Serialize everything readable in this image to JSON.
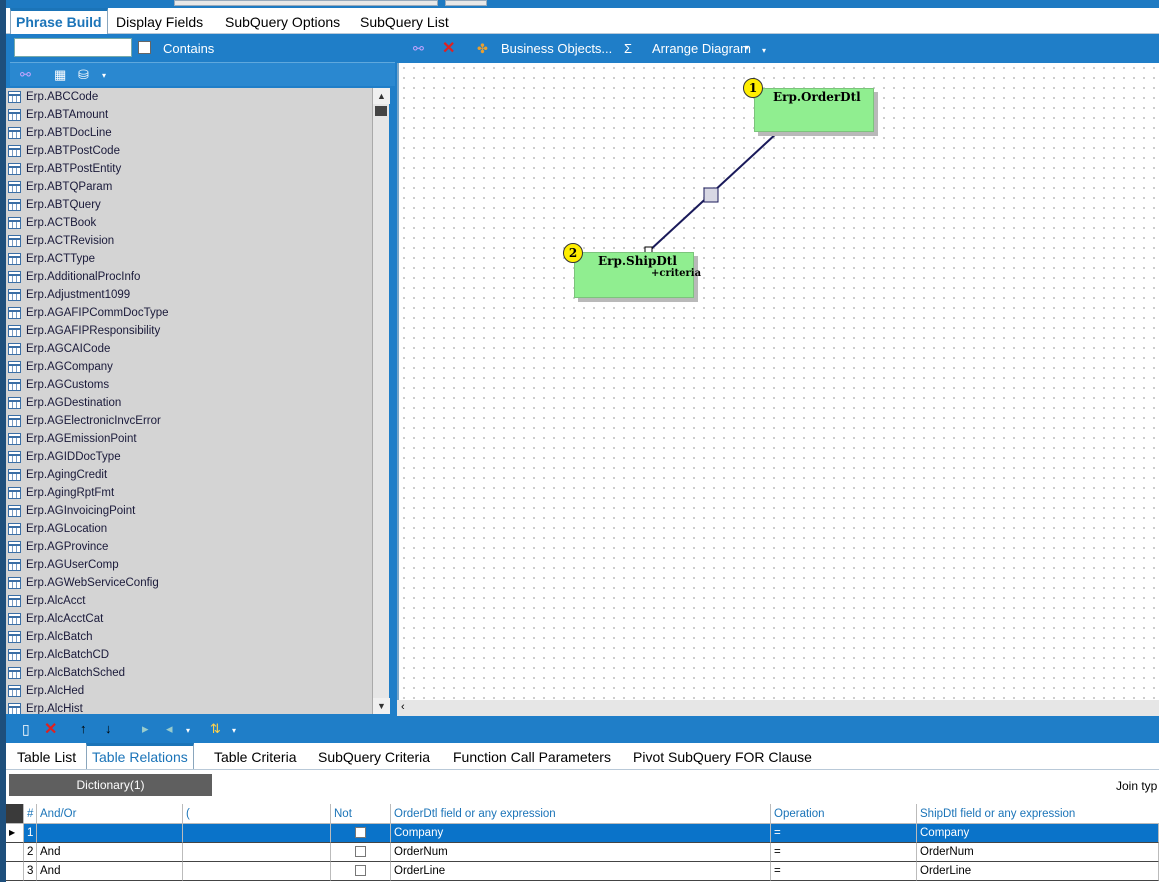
{
  "top_tabs": [
    {
      "label": "Phrase Build",
      "active": true
    },
    {
      "label": "Display Fields",
      "active": false
    },
    {
      "label": "SubQuery Options",
      "active": false
    },
    {
      "label": "SubQuery List",
      "active": false
    }
  ],
  "left_panel": {
    "search_value": "",
    "contains_label": "Contains",
    "tables": [
      "Erp.ABCCode",
      "Erp.ABTAmount",
      "Erp.ABTDocLine",
      "Erp.ABTPostCode",
      "Erp.ABTPostEntity",
      "Erp.ABTQParam",
      "Erp.ABTQuery",
      "Erp.ACTBook",
      "Erp.ACTRevision",
      "Erp.ACTType",
      "Erp.AdditionalProcInfo",
      "Erp.Adjustment1099",
      "Erp.AGAFIPCommDocType",
      "Erp.AGAFIPResponsibility",
      "Erp.AGCAICode",
      "Erp.AGCompany",
      "Erp.AGCustoms",
      "Erp.AGDestination",
      "Erp.AGElectronicInvcError",
      "Erp.AGEmissionPoint",
      "Erp.AGIDDocType",
      "Erp.AgingCredit",
      "Erp.AgingRptFmt",
      "Erp.AGInvoicingPoint",
      "Erp.AGLocation",
      "Erp.AGProvince",
      "Erp.AGUserComp",
      "Erp.AGWebServiceConfig",
      "Erp.AlcAcct",
      "Erp.AlcAcctCat",
      "Erp.AlcBatch",
      "Erp.AlcBatchCD",
      "Erp.AlcBatchSched",
      "Erp.AlcHed",
      "Erp.AlcHist"
    ]
  },
  "diagram_toolbar": {
    "business_objects_label": "Business Objects...",
    "sigma_label": "Σ",
    "arrange_label": "Arrange Diagram"
  },
  "diagram": {
    "entities": [
      {
        "number": "1",
        "name": "Erp.OrderDtl",
        "criteria": ""
      },
      {
        "number": "2",
        "name": "Erp.ShipDtl",
        "criteria": "+criteria"
      }
    ]
  },
  "bottom_tabs": [
    {
      "label": "Table List",
      "active": false
    },
    {
      "label": "Table Relations",
      "active": true
    },
    {
      "label": "Table Criteria",
      "active": false
    },
    {
      "label": "SubQuery Criteria",
      "active": false
    },
    {
      "label": "Function Call Parameters",
      "active": false
    },
    {
      "label": "Pivot SubQuery FOR Clause",
      "active": false
    }
  ],
  "relations": {
    "dictionary_label": "Dictionary(1)",
    "join_type_label": "Join typ",
    "columns": [
      "#",
      "And/Or",
      "(",
      "Not",
      "OrderDtl field or any expression",
      "Operation",
      "ShipDtl field or any expression"
    ],
    "rows": [
      {
        "num": "1",
        "andor": "",
        "paren": "",
        "not": false,
        "left": "Company",
        "op": "=",
        "right": "Company",
        "selected": true
      },
      {
        "num": "2",
        "andor": "And",
        "paren": "",
        "not": false,
        "left": "OrderNum",
        "op": "=",
        "right": "OrderNum",
        "selected": false
      },
      {
        "num": "3",
        "andor": "And",
        "paren": "",
        "not": false,
        "left": "OrderLine",
        "op": "=",
        "right": "OrderLine",
        "selected": false
      }
    ]
  },
  "colors": {
    "accent": "#1f7ec8",
    "entity_fill": "#90ee90",
    "badge": "#ffee00",
    "selected_row": "#0a73c9"
  }
}
